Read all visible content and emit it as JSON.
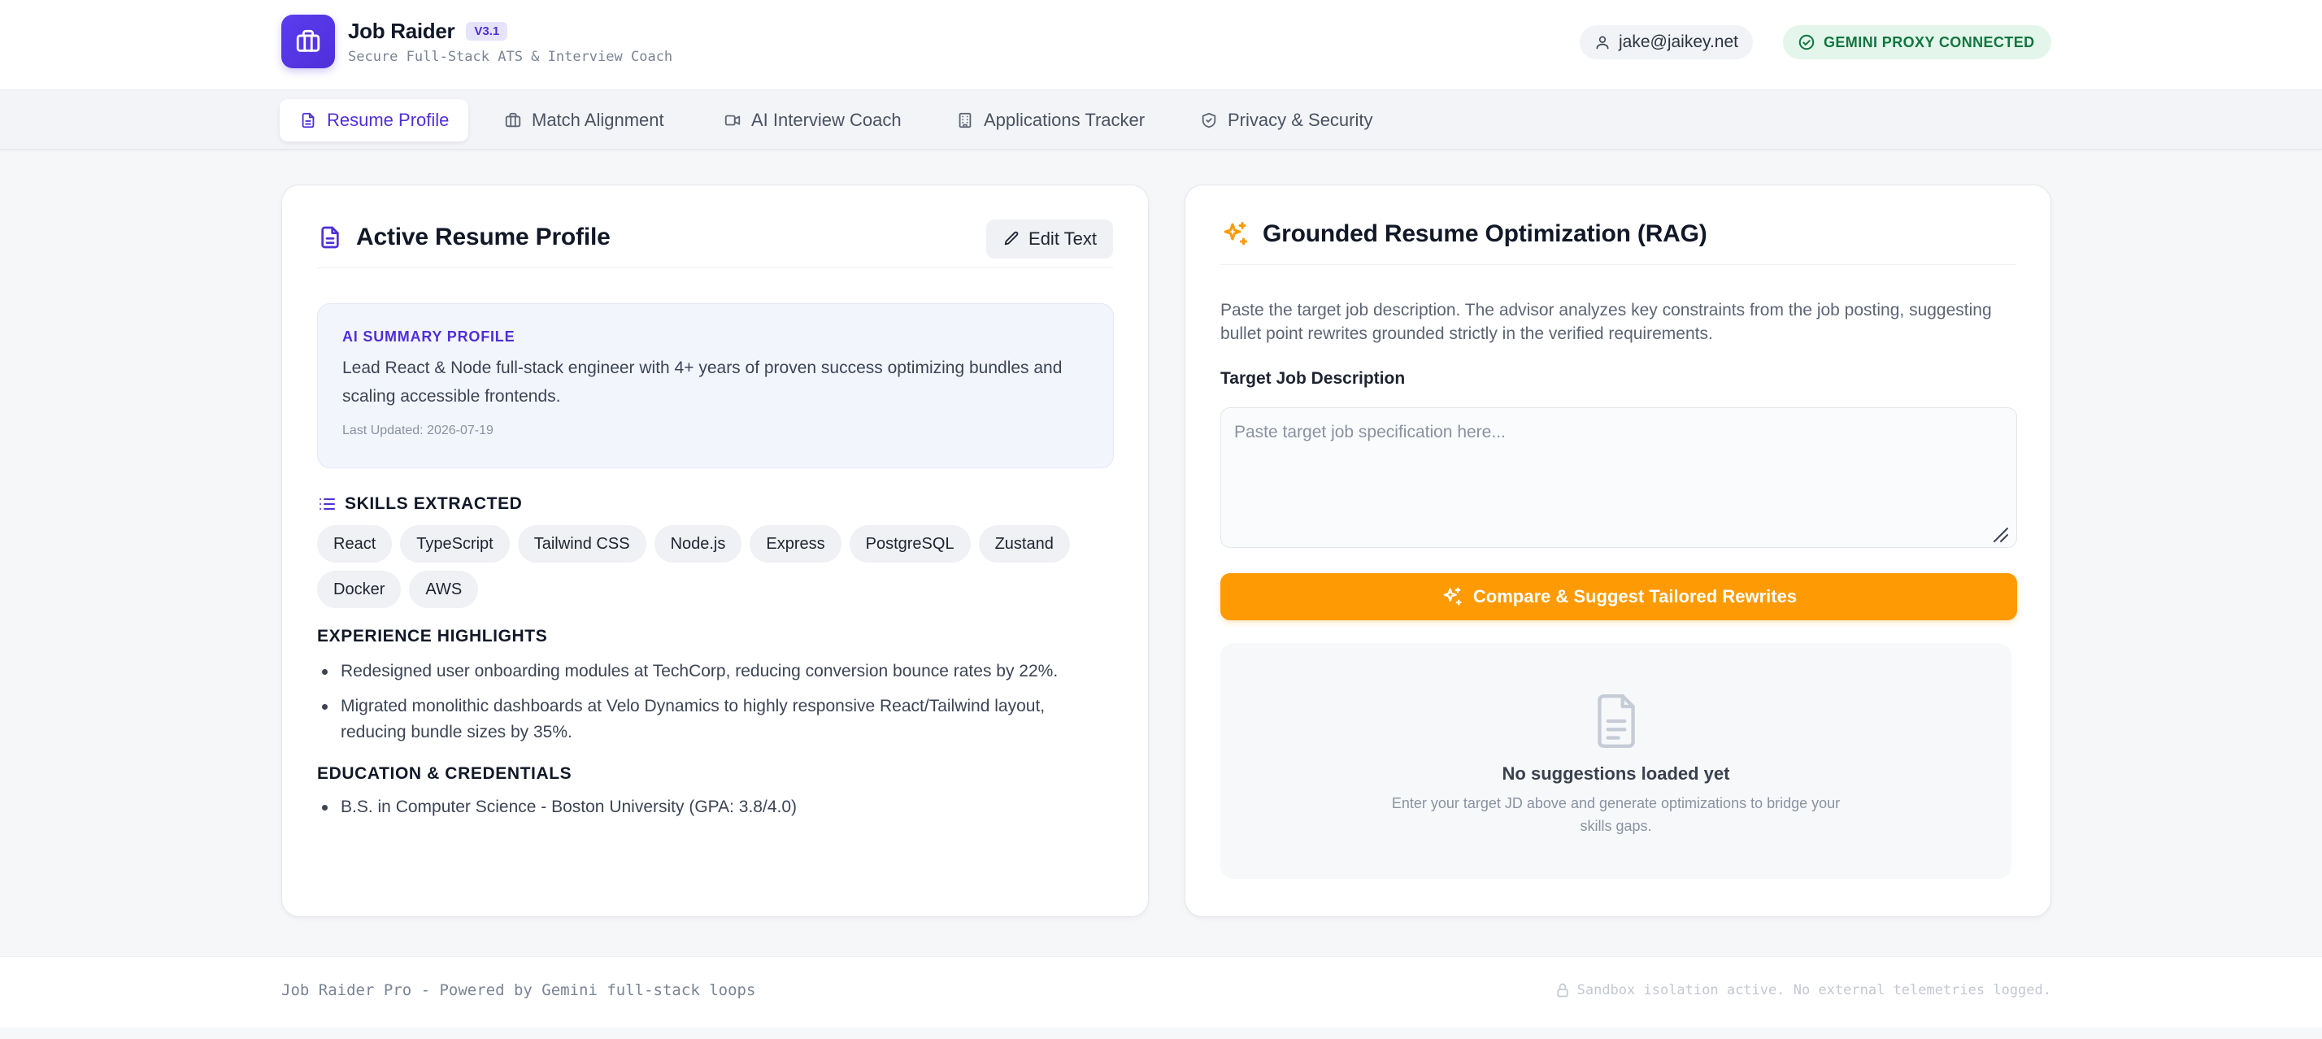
{
  "app": {
    "name": "Job Raider",
    "version": "V3.1",
    "subtitle": "Secure Full-Stack ATS & Interview Coach"
  },
  "header": {
    "user_email": "jake@jaikey.net",
    "status": "GEMINI PROXY CONNECTED"
  },
  "tabs": [
    {
      "label": "Resume Profile",
      "icon": "document-icon",
      "active": true
    },
    {
      "label": "Match Alignment",
      "icon": "briefcase-icon",
      "active": false
    },
    {
      "label": "AI Interview Coach",
      "icon": "video-camera-icon",
      "active": false
    },
    {
      "label": "Applications Tracker",
      "icon": "building-icon",
      "active": false
    },
    {
      "label": "Privacy & Security",
      "icon": "shield-icon",
      "active": false
    }
  ],
  "resume": {
    "title": "Active Resume Profile",
    "edit_label": "Edit Text",
    "summary_label": "AI SUMMARY PROFILE",
    "summary_text": "Lead React & Node full-stack engineer with 4+ years of proven success optimizing bundles and scaling accessible frontends.",
    "last_updated": "Last Updated: 2026-07-19",
    "skills_title": "SKILLS EXTRACTED",
    "skills": [
      "React",
      "TypeScript",
      "Tailwind CSS",
      "Node.js",
      "Express",
      "PostgreSQL",
      "Zustand",
      "Docker",
      "AWS"
    ],
    "experience_title": "EXPERIENCE HIGHLIGHTS",
    "experience": [
      "Redesigned user onboarding modules at TechCorp, reducing conversion bounce rates by 22%.",
      "Migrated monolithic dashboards at Velo Dynamics to highly responsive React/Tailwind layout, reducing bundle sizes by 35%."
    ],
    "education_title": "EDUCATION & CREDENTIALS",
    "education": [
      "B.S. in Computer Science - Boston University (GPA: 3.8/4.0)"
    ]
  },
  "rag": {
    "title": "Grounded Resume Optimization (RAG)",
    "description": "Paste the target job description. The advisor analyzes key constraints from the job posting, suggesting bullet point rewrites grounded strictly in the verified requirements.",
    "field_label": "Target Job Description",
    "field_value": "",
    "field_placeholder": "Paste target job specification here...",
    "cta_label": "Compare & Suggest Tailored Rewrites",
    "empty_title": "No suggestions loaded yet",
    "empty_subtitle": "Enter your target JD above and generate optimizations to bridge your skills gaps."
  },
  "footer": {
    "left": "Job Raider Pro - Powered by Gemini full-stack loops",
    "right": "Sandbox isolation active. No external telemetries logged."
  },
  "colors": {
    "brand": "#4f2fd8",
    "accent_orange": "#fe9a04",
    "success": "#11753f"
  }
}
